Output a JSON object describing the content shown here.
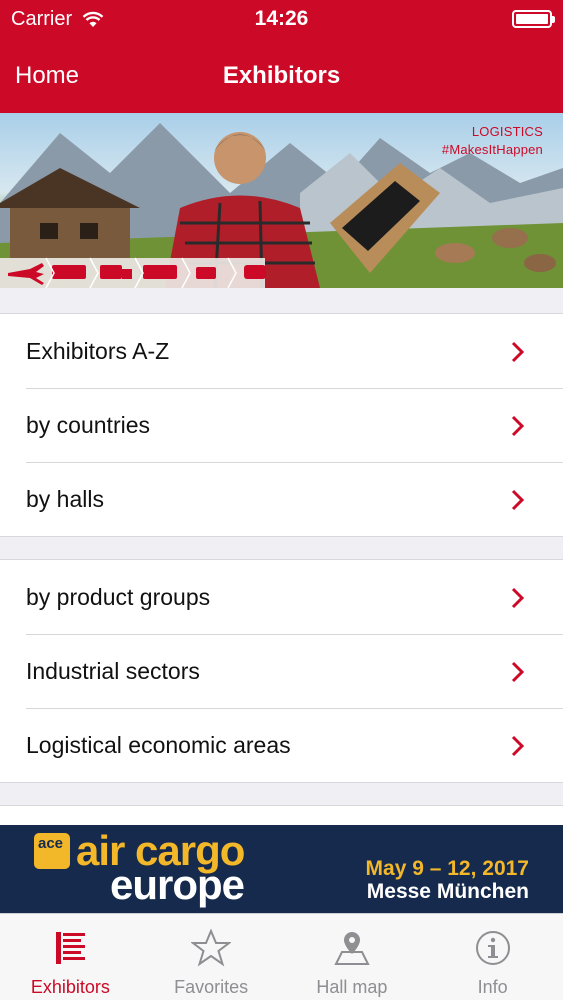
{
  "status_bar": {
    "carrier": "Carrier",
    "time": "14:26"
  },
  "nav": {
    "back_label": "Home",
    "title": "Exhibitors"
  },
  "hero": {
    "caption_line1": "LOGISTICS",
    "caption_line2": "#MakesItHappen"
  },
  "group1": [
    {
      "label": "Exhibitors A-Z"
    },
    {
      "label": "by countries"
    },
    {
      "label": "by halls"
    }
  ],
  "group2": [
    {
      "label": "by product groups"
    },
    {
      "label": "Industrial sectors"
    },
    {
      "label": "Logistical economic areas"
    }
  ],
  "banner": {
    "logo_text": "ace",
    "title_line1": "air cargo",
    "title_line2": "europe",
    "dates": "May 9 – 12, 2017",
    "venue": "Messe München"
  },
  "tabs": [
    {
      "label": "Exhibitors",
      "icon": "exhibitors-list-icon",
      "active": true
    },
    {
      "label": "Favorites",
      "icon": "star-icon",
      "active": false
    },
    {
      "label": "Hall map",
      "icon": "map-pin-icon",
      "active": false
    },
    {
      "label": "Info",
      "icon": "info-icon",
      "active": false
    }
  ],
  "colors": {
    "accent": "#cc0a27",
    "banner_bg": "#152a4c",
    "banner_gold": "#f3b72a"
  }
}
